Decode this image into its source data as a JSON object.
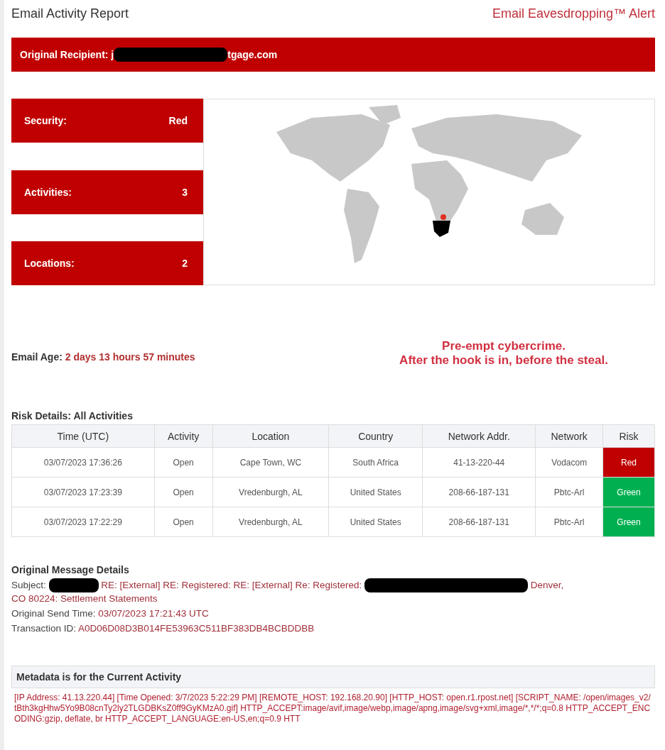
{
  "header": {
    "title": "Email Activity Report",
    "alert": "Email Eavesdropping™ Alert"
  },
  "recipient": {
    "label": "Original Recipient:",
    "prefix": "j",
    "suffix": "tgage.com"
  },
  "stats": [
    {
      "label": "Security:",
      "value": "Red"
    },
    {
      "label": "Activities:",
      "value": "3"
    },
    {
      "label": "Locations:",
      "value": "2"
    }
  ],
  "email_age": {
    "label": "Email Age:",
    "value": "2 days 13 hours 57 minutes"
  },
  "slogan": [
    "Pre-empt cybercrime.",
    "After the hook is in, before the steal."
  ],
  "risk_details": {
    "title": "Risk Details: All Activities",
    "columns": [
      "Time (UTC)",
      "Activity",
      "Location",
      "Country",
      "Network Addr.",
      "Network",
      "Risk"
    ],
    "rows": [
      {
        "cells": [
          "03/07/2023 17:36:26",
          "Open",
          "Cape Town, WC",
          "South Africa",
          "41-13-220-44",
          "Vodacom"
        ],
        "risk": "Red",
        "color": "#c00000"
      },
      {
        "cells": [
          "03/07/2023 17:23:39",
          "Open",
          "Vredenburgh, AL",
          "United States",
          "208-66-187-131",
          "Pbtc-Arl"
        ],
        "risk": "Green",
        "color": "#00b050"
      },
      {
        "cells": [
          "03/07/2023 17:22:29",
          "Open",
          "Vredenburgh, AL",
          "United States",
          "208-66-187-131",
          "Pbtc-Arl"
        ],
        "risk": "Green",
        "color": "#00b050"
      }
    ]
  },
  "message": {
    "title": "Original Message Details",
    "subject_label": "Subject:",
    "subject_part1": "RE: [External] RE: Registered: RE: [External] Re: Registered:",
    "subject_part2": "Denver,",
    "subject_part3": "CO 80224: Settlement Statements",
    "fields": [
      {
        "label": "Original Send Time:",
        "value": "03/07/2023 17:21:43 UTC"
      },
      {
        "label": "Transaction ID:",
        "value": "A0D06D08D3B014FE53963C511BF383DB4BCBDDBB"
      }
    ]
  },
  "metadata": {
    "title": "Metadata is for the Current Activity",
    "text": "[IP Address: 41.13.220.44] [Time Opened: 3/7/2023 5:22:29 PM] [REMOTE_HOST: 192.168.20.90] [HTTP_HOST: open.r1.rpost.net] [SCRIPT_NAME: /open/images_v2/tBth3kgHhw5Yo9B08cnTy2ly2TLGDBKsZ0ff9GyKMzA0.gif] HTTP_ACCEPT:image/avif,image/webp,image/apng,image/svg+xml,image/*,*/*;q=0.8 HTTP_ACCEPT_ENCODING:gzip, deflate, br HTTP_ACCEPT_LANGUAGE:en-US,en;q=0.9 HTT"
  }
}
